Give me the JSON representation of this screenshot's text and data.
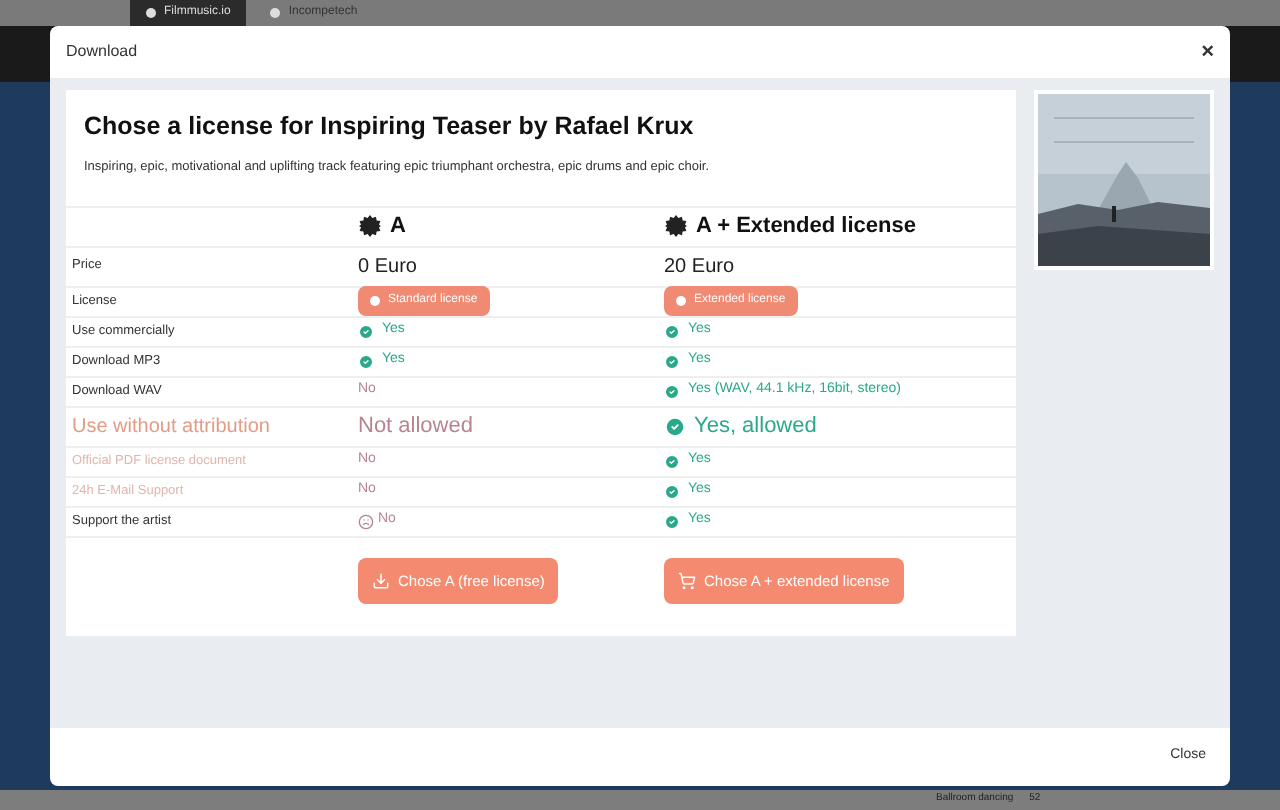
{
  "background": {
    "tabs": [
      {
        "label": "Filmmusic.io",
        "selected": true
      },
      {
        "label": "Incompetech",
        "selected": false
      }
    ],
    "footer_text": "Ballroom dancing",
    "footer_count": "52"
  },
  "modal": {
    "title": "Download",
    "close_glyph": "×",
    "footer_button": "Close"
  },
  "card": {
    "title_prefix": "Chose a license for ",
    "title_track": "Inspiring Teaser by Rafael Krux",
    "description": "Inspiring, epic, motivational and uplifting track featuring epic triumphant orchestra, epic drums and epic choir.",
    "plans": [
      {
        "name": "A"
      },
      {
        "name": "A + Extended license"
      }
    ],
    "rows": [
      {
        "label": "Price",
        "kind": "plain",
        "cells": [
          {
            "kind": "price",
            "text": "0 Euro"
          },
          {
            "kind": "price",
            "text": "20 Euro"
          }
        ]
      },
      {
        "label": "License",
        "kind": "plain",
        "cells": [
          {
            "kind": "badge",
            "text": "Standard license"
          },
          {
            "kind": "badge",
            "text": "Extended license"
          }
        ]
      },
      {
        "label": "Use commercially",
        "kind": "plain",
        "cells": [
          {
            "kind": "yes",
            "text": "Yes"
          },
          {
            "kind": "yes",
            "text": "Yes"
          }
        ]
      },
      {
        "label": "Download MP3",
        "kind": "plain",
        "cells": [
          {
            "kind": "yes",
            "text": "Yes"
          },
          {
            "kind": "yes",
            "text": "Yes"
          }
        ]
      },
      {
        "label": "Download WAV",
        "kind": "plain",
        "cells": [
          {
            "kind": "no",
            "text": "No"
          },
          {
            "kind": "yes",
            "text": "Yes (WAV, 44.1 kHz, 16bit, stereo)"
          }
        ]
      },
      {
        "label": "Use without attribution",
        "kind": "highlight",
        "cells": [
          {
            "kind": "no",
            "text": "Not allowed"
          },
          {
            "kind": "yes",
            "text": "Yes, allowed"
          }
        ]
      },
      {
        "label": "Official PDF license document",
        "kind": "faint",
        "cells": [
          {
            "kind": "no",
            "text": "No"
          },
          {
            "kind": "yes",
            "text": "Yes"
          }
        ]
      },
      {
        "label": "24h E-Mail Support",
        "kind": "faint",
        "cells": [
          {
            "kind": "no",
            "text": "No"
          },
          {
            "kind": "yes",
            "text": "Yes"
          }
        ]
      },
      {
        "label": "Support the artist",
        "kind": "plain",
        "cells": [
          {
            "kind": "sad",
            "text": "No"
          },
          {
            "kind": "yes",
            "text": "Yes"
          }
        ]
      }
    ],
    "buttons": [
      {
        "kind": "download",
        "label": "Chose A (free license)"
      },
      {
        "kind": "cart",
        "label": "Chose A + extended license"
      }
    ]
  }
}
